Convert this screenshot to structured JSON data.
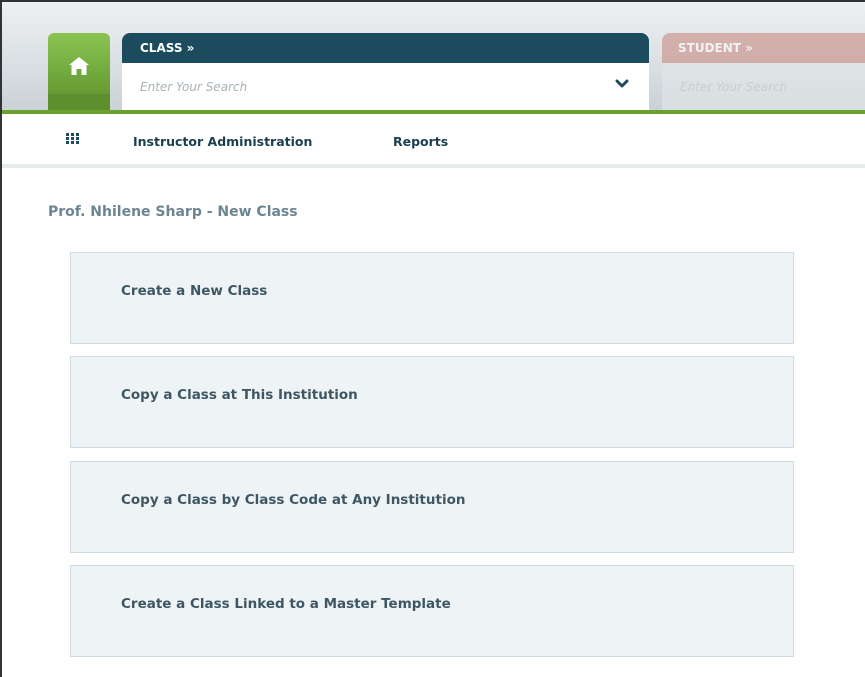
{
  "header": {
    "class_label": "CLASS »",
    "class_search_placeholder": "Enter Your Search",
    "student_label": "STUDENT »",
    "student_search_placeholder": "Enter Your Search"
  },
  "nav": {
    "items": [
      {
        "label": "Instructor Administration"
      },
      {
        "label": "Reports"
      }
    ]
  },
  "page": {
    "title": "Prof. Nhilene Sharp - New Class"
  },
  "options": [
    {
      "label": "Create a New Class"
    },
    {
      "label": "Copy a Class at This Institution"
    },
    {
      "label": "Copy a Class by Class Code at Any Institution"
    },
    {
      "label": "Create a Class Linked to a Master Template"
    }
  ],
  "colors": {
    "accent_green": "#6aa12f",
    "header_dark": "#1b4b5c",
    "student_header": "#c9847b"
  }
}
